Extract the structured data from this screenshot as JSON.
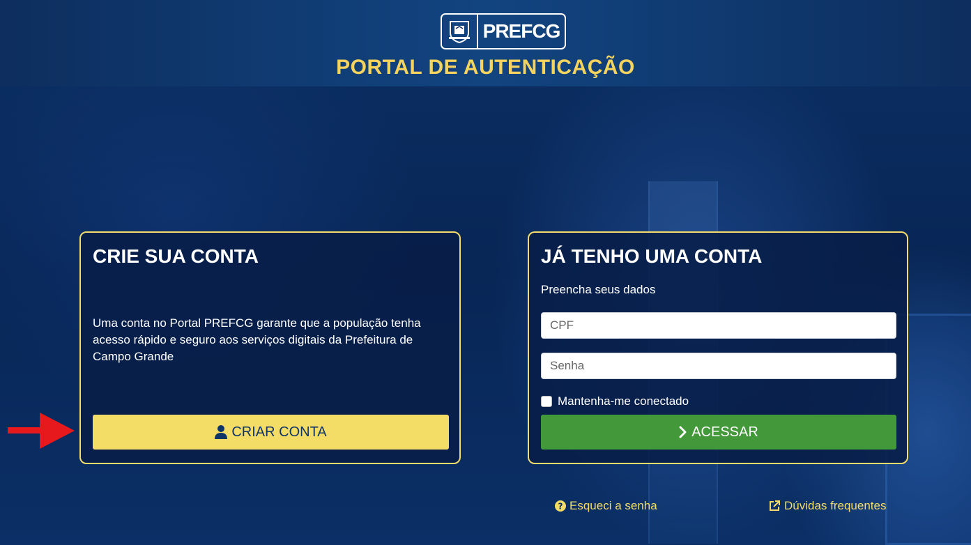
{
  "header": {
    "logo_text_pref": "PREF",
    "logo_text_cg": "CG",
    "portal_title": "PORTAL DE AUTENTICAÇÃO"
  },
  "create_account": {
    "title": "CRIE SUA CONTA",
    "description": "Uma conta no Portal PREFCG garante que a população tenha acesso rápido e seguro aos serviços digitais da Prefeitura de Campo Grande",
    "button_label": "CRIAR CONTA",
    "button_icon": "user-icon"
  },
  "login": {
    "title": "JÁ TENHO UMA CONTA",
    "subtitle": "Preencha seus dados",
    "cpf_placeholder": "CPF",
    "cpf_value": "",
    "password_placeholder": "Senha",
    "password_value": "",
    "remember_label": "Mantenha-me conectado",
    "remember_checked": false,
    "button_label": "ACESSAR",
    "button_icon": "chevron-right-icon"
  },
  "links": {
    "forgot_password": "Esqueci a senha",
    "faq": "Dúvidas frequentes"
  },
  "colors": {
    "accent_yellow": "#f4dd67",
    "access_green": "#43993a",
    "background_blue": "#0a2a5c",
    "annotation_arrow_red": "#e8191c"
  }
}
